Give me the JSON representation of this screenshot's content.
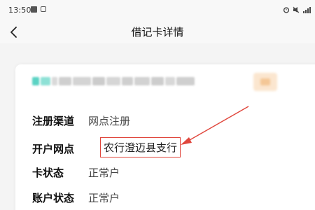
{
  "status_bar": {
    "time": "13:50",
    "left_icons": [
      "image-notification-icon",
      "app-notification-icon"
    ],
    "right_icons": [
      "alarm-icon",
      "mute-icon",
      "signal-icon"
    ]
  },
  "header": {
    "back_icon": "chevron-left-icon",
    "title": "借记卡详情"
  },
  "card": {
    "masked_number_note": "",
    "bank_logo_icon": "bank-logo-icon",
    "rows": [
      {
        "label": "注册渠道",
        "value": "网点注册"
      },
      {
        "label": "开户网点",
        "value": "农行澄迈县支行"
      },
      {
        "label": "卡状态",
        "value": "正常户"
      },
      {
        "label": "账户状态",
        "value": "正常户"
      }
    ]
  },
  "colors": {
    "annotation_red": "#e0463c",
    "mask_teal": "#5bd3c4",
    "mask_gray": "#cfcfcf",
    "logo_orange": "#f4c796"
  }
}
